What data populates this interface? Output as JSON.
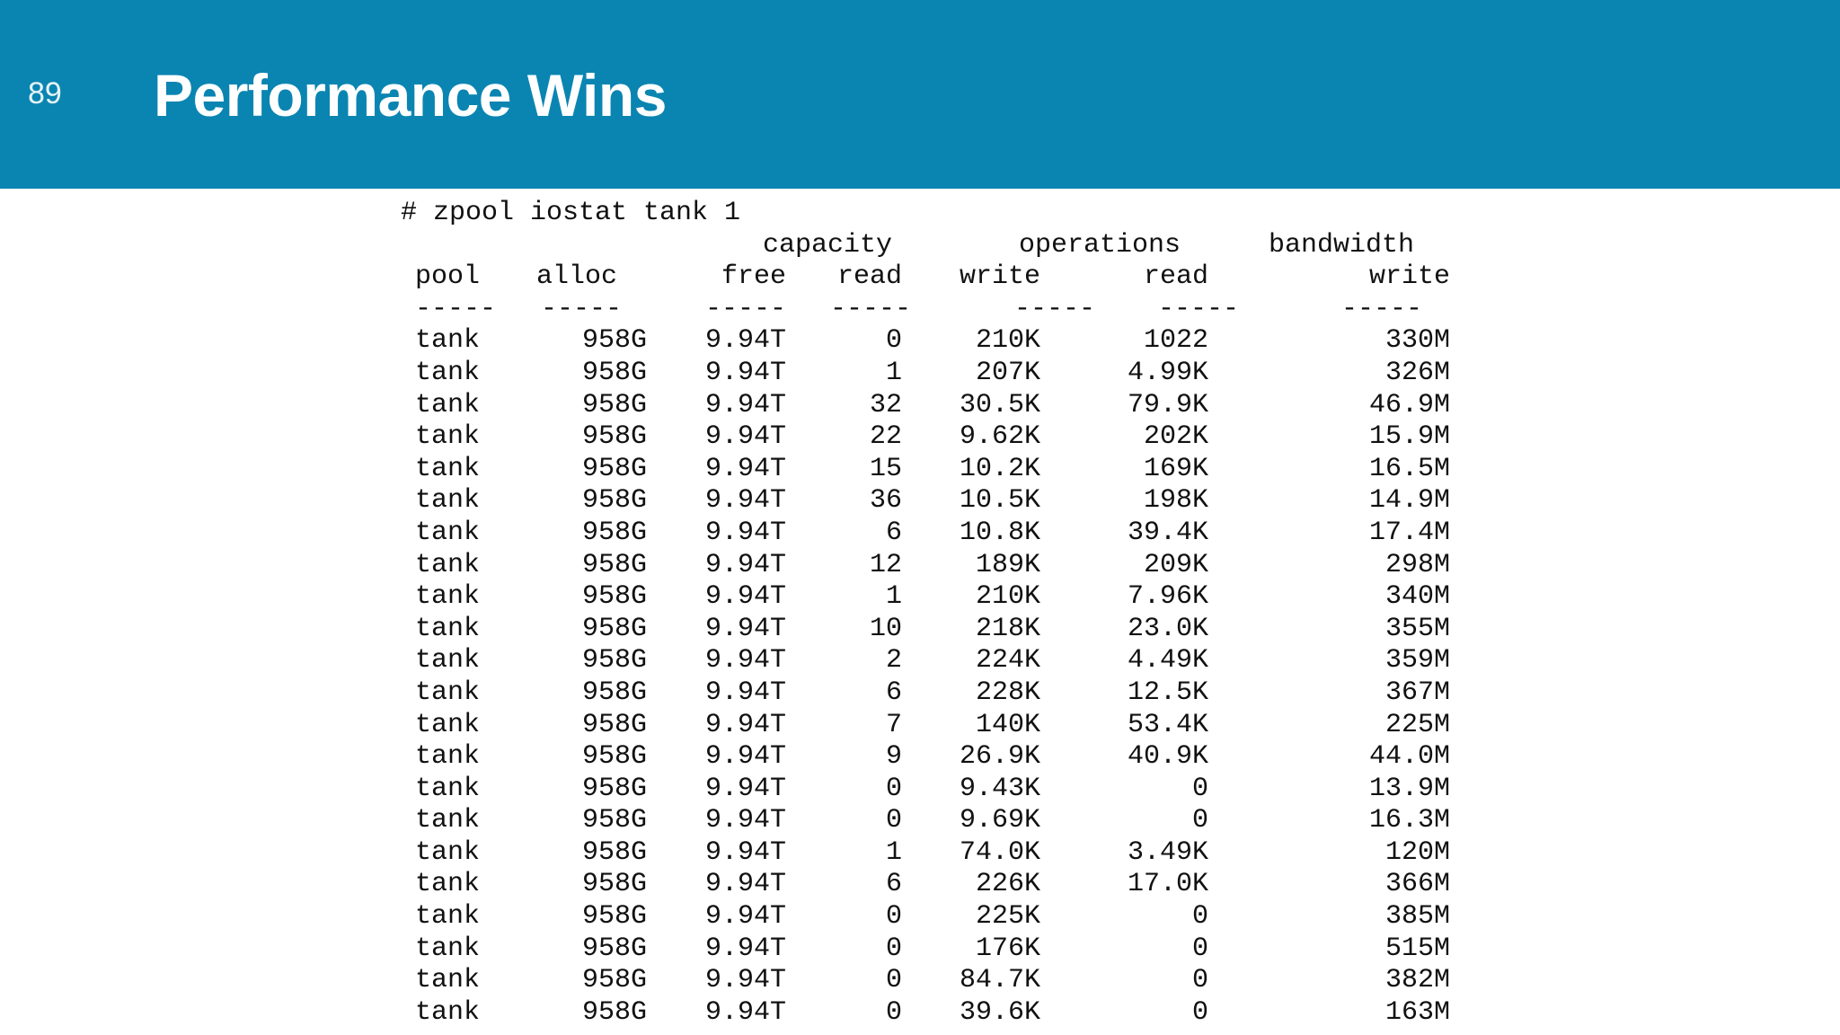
{
  "slide": {
    "number": "89",
    "title": "Performance Wins",
    "header_color": "#0a85b1"
  },
  "terminal": {
    "command": "# zpool iostat tank 1",
    "group_headers": {
      "capacity": "capacity",
      "operations": "operations",
      "bandwidth": "bandwidth"
    },
    "column_headers": [
      "pool",
      "alloc",
      "free",
      "read",
      "write",
      "read",
      "write"
    ],
    "separator": "-----",
    "rows": [
      [
        "tank",
        "958G",
        "9.94T",
        "0",
        "210K",
        "1022",
        "330M"
      ],
      [
        "tank",
        "958G",
        "9.94T",
        "1",
        "207K",
        "4.99K",
        "326M"
      ],
      [
        "tank",
        "958G",
        "9.94T",
        "32",
        "30.5K",
        "79.9K",
        "46.9M"
      ],
      [
        "tank",
        "958G",
        "9.94T",
        "22",
        "9.62K",
        "202K",
        "15.9M"
      ],
      [
        "tank",
        "958G",
        "9.94T",
        "15",
        "10.2K",
        "169K",
        "16.5M"
      ],
      [
        "tank",
        "958G",
        "9.94T",
        "36",
        "10.5K",
        "198K",
        "14.9M"
      ],
      [
        "tank",
        "958G",
        "9.94T",
        "6",
        "10.8K",
        "39.4K",
        "17.4M"
      ],
      [
        "tank",
        "958G",
        "9.94T",
        "12",
        "189K",
        "209K",
        "298M"
      ],
      [
        "tank",
        "958G",
        "9.94T",
        "1",
        "210K",
        "7.96K",
        "340M"
      ],
      [
        "tank",
        "958G",
        "9.94T",
        "10",
        "218K",
        "23.0K",
        "355M"
      ],
      [
        "tank",
        "958G",
        "9.94T",
        "2",
        "224K",
        "4.49K",
        "359M"
      ],
      [
        "tank",
        "958G",
        "9.94T",
        "6",
        "228K",
        "12.5K",
        "367M"
      ],
      [
        "tank",
        "958G",
        "9.94T",
        "7",
        "140K",
        "53.4K",
        "225M"
      ],
      [
        "tank",
        "958G",
        "9.94T",
        "9",
        "26.9K",
        "40.9K",
        "44.0M"
      ],
      [
        "tank",
        "958G",
        "9.94T",
        "0",
        "9.43K",
        "0",
        "13.9M"
      ],
      [
        "tank",
        "958G",
        "9.94T",
        "0",
        "9.69K",
        "0",
        "16.3M"
      ],
      [
        "tank",
        "958G",
        "9.94T",
        "1",
        "74.0K",
        "3.49K",
        "120M"
      ],
      [
        "tank",
        "958G",
        "9.94T",
        "6",
        "226K",
        "17.0K",
        "366M"
      ],
      [
        "tank",
        "958G",
        "9.94T",
        "0",
        "225K",
        "0",
        "385M"
      ],
      [
        "tank",
        "958G",
        "9.94T",
        "0",
        "176K",
        "0",
        "515M"
      ],
      [
        "tank",
        "958G",
        "9.94T",
        "0",
        "84.7K",
        "0",
        "382M"
      ],
      [
        "tank",
        "958G",
        "9.94T",
        "0",
        "39.6K",
        "0",
        "163M"
      ]
    ]
  }
}
